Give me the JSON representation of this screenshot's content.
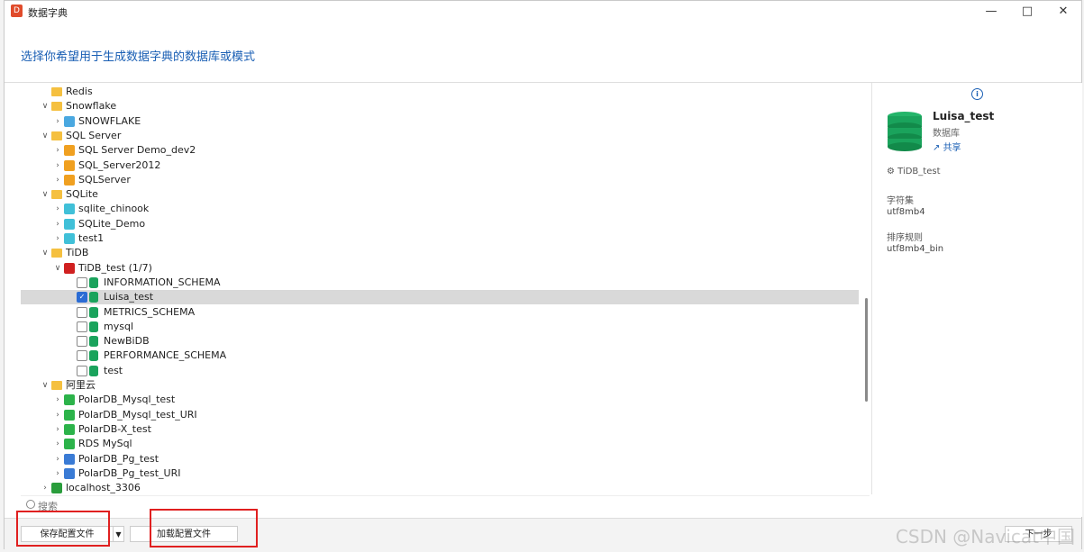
{
  "window": {
    "title": "数据字典",
    "app_icon": "D"
  },
  "header": {
    "prompt": "选择你希望用于生成数据字典的数据库或模式"
  },
  "tree": [
    {
      "label": "Redis",
      "level": 1,
      "kind": "folder",
      "expander": ""
    },
    {
      "label": "Snowflake",
      "level": 1,
      "kind": "folder",
      "expander": "open"
    },
    {
      "label": "SNOWFLAKE",
      "level": 2,
      "kind": "snowflake",
      "expander": "closed"
    },
    {
      "label": "SQL Server",
      "level": 1,
      "kind": "folder",
      "expander": "open"
    },
    {
      "label": "SQL Server Demo_dev2",
      "level": 2,
      "kind": "sqlserver",
      "expander": "closed"
    },
    {
      "label": "SQL_Server2012",
      "level": 2,
      "kind": "sqlserver",
      "expander": "closed"
    },
    {
      "label": "SQLServer",
      "level": 2,
      "kind": "sqlserver",
      "expander": "closed"
    },
    {
      "label": "SQLite",
      "level": 1,
      "kind": "folder",
      "expander": "open"
    },
    {
      "label": "sqlite_chinook",
      "level": 2,
      "kind": "sqlite",
      "expander": "closed"
    },
    {
      "label": "SQLite_Demo",
      "level": 2,
      "kind": "sqlite",
      "expander": "closed"
    },
    {
      "label": "test1",
      "level": 2,
      "kind": "sqlite",
      "expander": "closed"
    },
    {
      "label": "TiDB",
      "level": 1,
      "kind": "folder",
      "expander": "open"
    },
    {
      "label": "TiDB_test (1/7)",
      "level": 2,
      "kind": "tidb",
      "expander": "open"
    },
    {
      "label": "INFORMATION_SCHEMA",
      "level": 3,
      "kind": "db",
      "checked": false
    },
    {
      "label": "Luisa_test",
      "level": 3,
      "kind": "db",
      "checked": true,
      "selected": true
    },
    {
      "label": "METRICS_SCHEMA",
      "level": 3,
      "kind": "db",
      "checked": false
    },
    {
      "label": "mysql",
      "level": 3,
      "kind": "db",
      "checked": false
    },
    {
      "label": "NewBiDB",
      "level": 3,
      "kind": "db",
      "checked": false
    },
    {
      "label": "PERFORMANCE_SCHEMA",
      "level": 3,
      "kind": "db",
      "checked": false
    },
    {
      "label": "test",
      "level": 3,
      "kind": "db",
      "checked": false
    },
    {
      "label": "阿里云",
      "level": 1,
      "kind": "folder",
      "expander": "open"
    },
    {
      "label": "PolarDB_Mysql_test",
      "level": 2,
      "kind": "polar",
      "expander": "closed"
    },
    {
      "label": "PolarDB_Mysql_test_URI",
      "level": 2,
      "kind": "polar",
      "expander": "closed"
    },
    {
      "label": "PolarDB-X_test",
      "level": 2,
      "kind": "polar",
      "expander": "closed"
    },
    {
      "label": "RDS MySql",
      "level": 2,
      "kind": "polar",
      "expander": "closed"
    },
    {
      "label": "PolarDB_Pg_test",
      "level": 2,
      "kind": "polarpg",
      "expander": "closed"
    },
    {
      "label": "PolarDB_Pg_test_URI",
      "level": 2,
      "kind": "polarpg",
      "expander": "closed"
    },
    {
      "label": "localhost_3306",
      "level": 1,
      "kind": "mysql",
      "expander": "closed"
    }
  ],
  "search": {
    "placeholder": "搜索"
  },
  "info": {
    "name": "Luisa_test",
    "type": "数据库",
    "share": "共享",
    "connection": "TiDB_test",
    "charset_label": "字符集",
    "charset_value": "utf8mb4",
    "collation_label": "排序规则",
    "collation_value": "utf8mb4_bin"
  },
  "footer": {
    "save_label": "保存配置文件",
    "load_label": "加载配置文件",
    "next_label": "下一步"
  },
  "watermark": "CSDN @Navicat中国",
  "colors": {
    "accent": "#1a5fb4",
    "db_green": "#1aa35c",
    "folder": "#f5c040",
    "highlight_box": "#e02020"
  }
}
